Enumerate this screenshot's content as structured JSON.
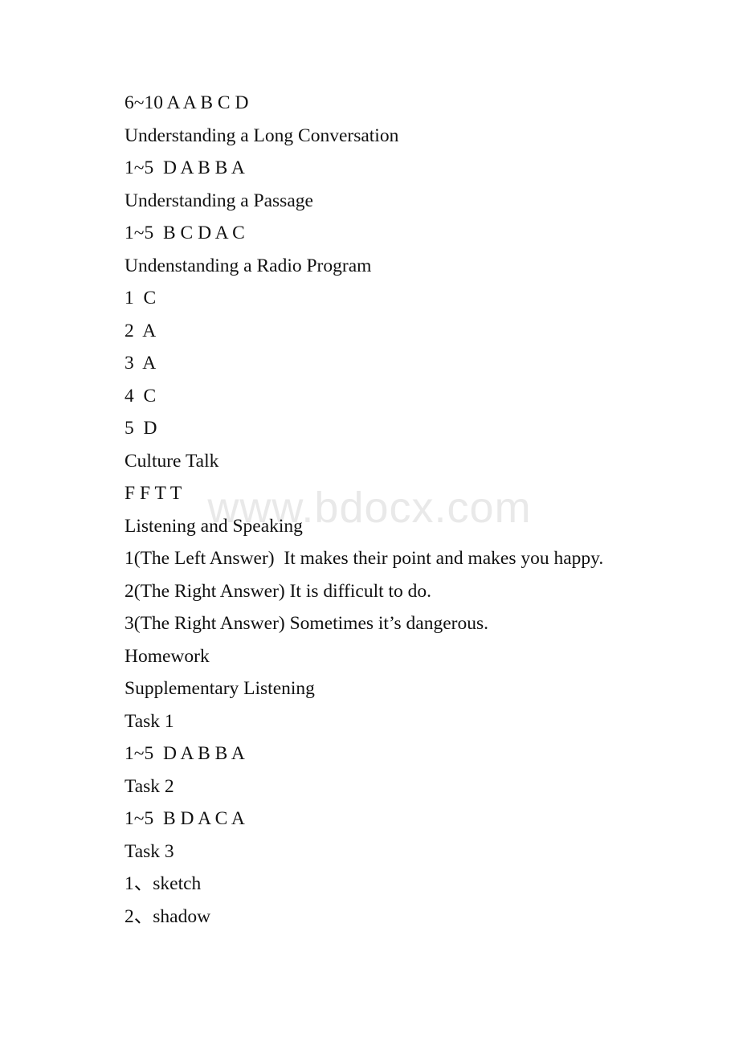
{
  "document": {
    "watermark": "www.bdocx.com",
    "watermark_color": "#e9e9e9",
    "page_background": "#ffffff",
    "text_color": "#111111",
    "lines": [
      {
        "text": "6~10 A A B C D",
        "kind": "answers"
      },
      {
        "text": "Understanding a Long Conversation",
        "kind": "heading"
      },
      {
        "text": "1~5  D A B B A",
        "kind": "answers"
      },
      {
        "text": "Understanding a Passage",
        "kind": "heading"
      },
      {
        "text": "1~5  B C D A C",
        "kind": "answers"
      },
      {
        "text": "Undenstanding a Radio Program",
        "kind": "heading"
      },
      {
        "text": "1  C",
        "kind": "answers"
      },
      {
        "text": "2  A",
        "kind": "answers"
      },
      {
        "text": "3  A",
        "kind": "answers"
      },
      {
        "text": "4  C",
        "kind": "answers"
      },
      {
        "text": "5  D",
        "kind": "answers"
      },
      {
        "text": "Culture Talk",
        "kind": "heading"
      },
      {
        "text": "F F T T",
        "kind": "answers"
      },
      {
        "text": "Listening and Speaking",
        "kind": "heading"
      },
      {
        "text": "1(The Left Answer)  It makes their point and makes you happy.",
        "kind": "answers"
      },
      {
        "text": "2(The Right Answer) It is difficult to do.",
        "kind": "answers"
      },
      {
        "text": "3(The Right Answer) Sometimes it’s dangerous.",
        "kind": "answers"
      },
      {
        "text": "Homework",
        "kind": "heading"
      },
      {
        "text": "Supplementary Listening",
        "kind": "heading"
      },
      {
        "text": "Task 1",
        "kind": "heading"
      },
      {
        "text": "1~5  D A B B A",
        "kind": "answers"
      },
      {
        "text": "Task 2",
        "kind": "heading"
      },
      {
        "text": "1~5  B D A C A",
        "kind": "answers"
      },
      {
        "text": "Task 3",
        "kind": "heading"
      },
      {
        "text": "1、sketch",
        "kind": "answers"
      },
      {
        "text": "2、shadow",
        "kind": "answers"
      }
    ]
  }
}
